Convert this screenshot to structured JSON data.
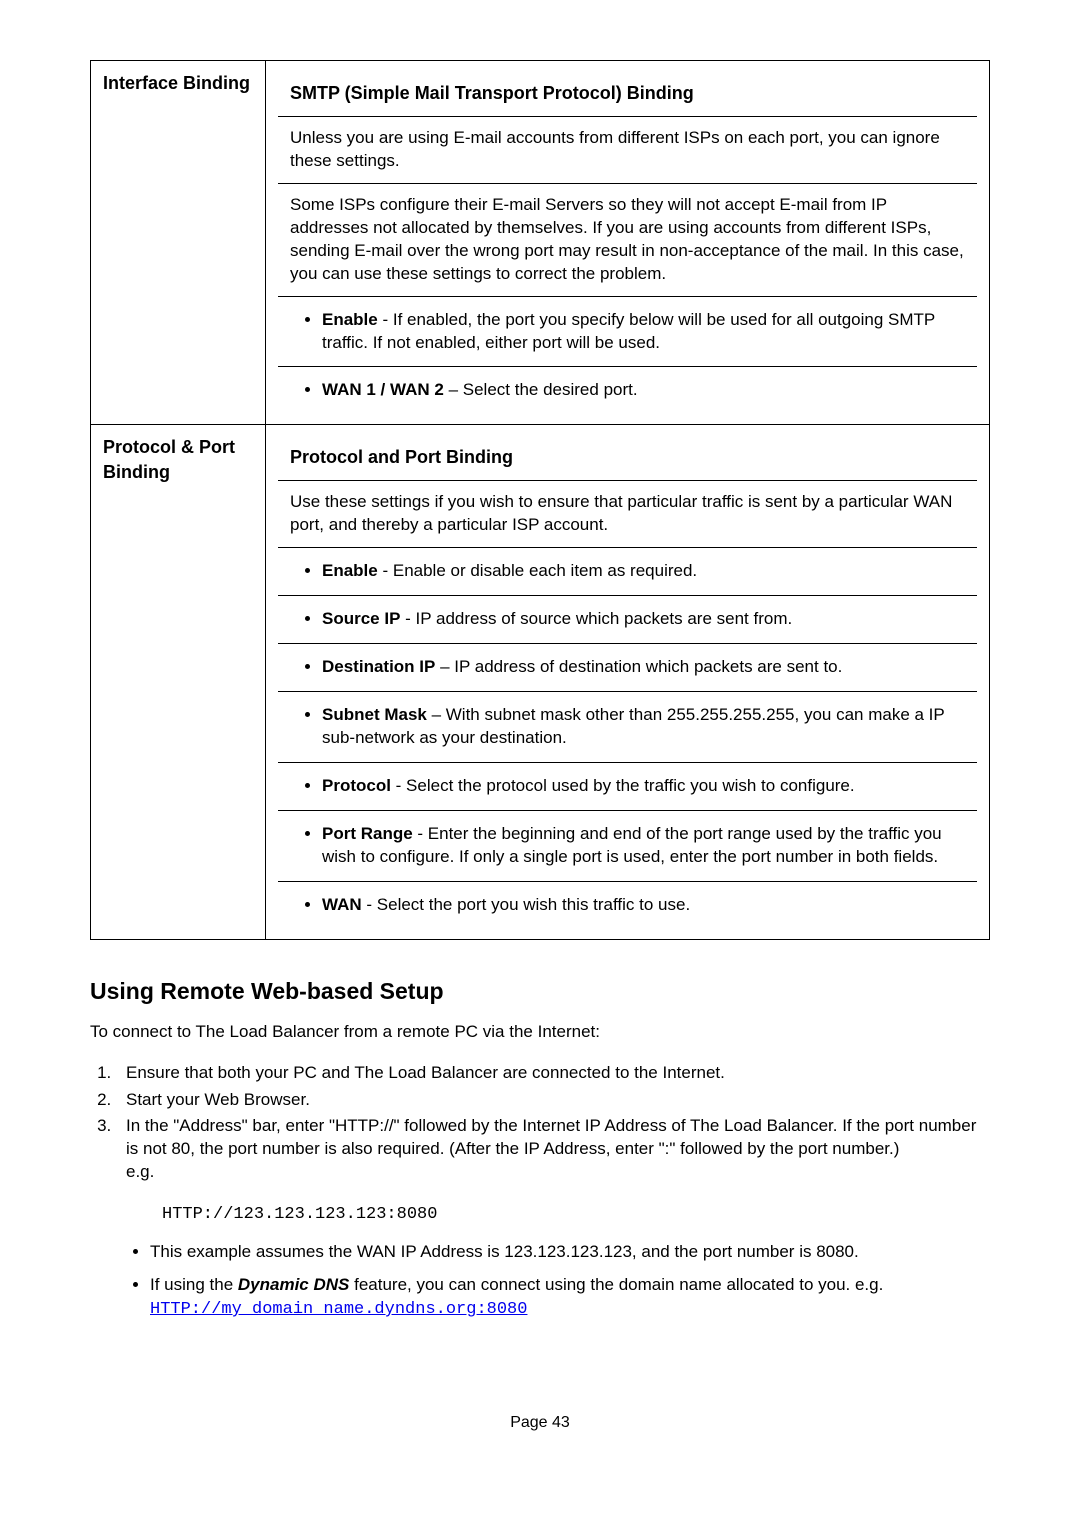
{
  "table": {
    "row1": {
      "label": "Interface Binding",
      "head": "SMTP (Simple Mail Transport Protocol) Binding",
      "p1": "Unless you are using E-mail accounts from different ISPs on each port, you can ignore these settings.",
      "p2": "Some ISPs configure their E-mail Servers so they will not accept E-mail from IP addresses not allocated by themselves. If you are using accounts from different ISPs, sending E-mail over the wrong port may result in non-acceptance of the mail. In this case, you can use these settings to correct the problem.",
      "b1": {
        "bold": "Enable",
        "rest": "  - If enabled, the port you specify below will be used for all outgoing SMTP traffic. If not enabled, either port will be used."
      },
      "b2": {
        "bold": "WAN 1 / WAN 2",
        "rest": " – Select the desired port."
      }
    },
    "row2": {
      "label": "Protocol & Port Binding",
      "head": "Protocol and Port Binding",
      "p1": "Use these settings if you wish to ensure that particular traffic is sent by a particular WAN port, and thereby a particular ISP account.",
      "b1": {
        "bold": "Enable",
        "rest": " - Enable or disable each item as required."
      },
      "b2": {
        "bold": "Source IP",
        "rest": " - IP address of source which packets are sent from."
      },
      "b3": {
        "bold": "Destination IP",
        "rest": " – IP address of destination which packets are sent to."
      },
      "b4": {
        "bold": "Subnet Mask",
        "rest": "  – With subnet mask other than 255.255.255.255, you can make a IP sub-network as your destination."
      },
      "b5": {
        "bold": "Protocol",
        "rest": " - Select the protocol used by the traffic you wish to configure."
      },
      "b6": {
        "bold": "Port Range",
        "rest": " - Enter the beginning and end of the port range used by the traffic you wish to configure. If only a single port is used, enter the port number in both fields."
      },
      "b7": {
        "bold": "WAN",
        "rest": " - Select the port you wish this traffic to use."
      }
    }
  },
  "section": {
    "heading": "Using Remote Web-based Setup",
    "intro": "To connect to The Load Balancer from a remote PC via the Internet:",
    "steps": {
      "s1": "Ensure that both your PC and The Load Balancer are connected to the Internet.",
      "s2": "Start your Web Browser.",
      "s3": "In the \"Address\" bar, enter \"HTTP://\" followed by the Internet IP Address of The Load Balancer. If the port number is not 80, the port number is also required. (After the IP Address, enter \":\" followed by the port number.)",
      "s3eg": "e.g."
    },
    "code1": "HTTP://123.123.123.123:8080",
    "bottom": {
      "b1": "This example assumes the WAN IP Address is 123.123.123.123, and the port number is 8080.",
      "b2a": "If using the ",
      "b2bold": "Dynamic DNS",
      "b2b": " feature, you can connect using the domain name allocated to you. e.g.",
      "b2link": "HTTP://my_domain_name.dyndns.org:8080"
    }
  },
  "pagenum": "Page 43"
}
